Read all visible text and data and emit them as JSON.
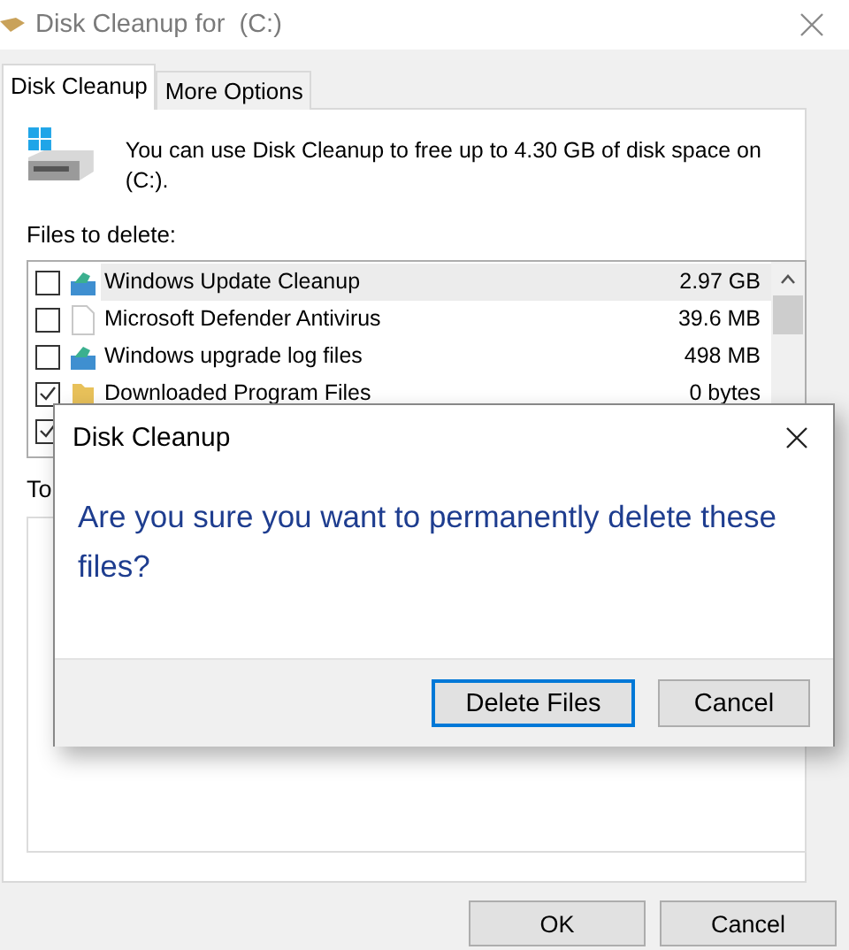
{
  "window": {
    "title": "Disk Cleanup for  (C:)"
  },
  "tabs": [
    {
      "label": "Disk Cleanup",
      "selected": true
    },
    {
      "label": "More Options",
      "selected": false
    }
  ],
  "intro": "You can use Disk Cleanup to free up to 4.30 GB of disk space on (C:).",
  "files_label": "Files to delete:",
  "files": [
    {
      "kind": "update",
      "name": "Windows Update Cleanup",
      "size": "2.97 GB",
      "checked": false,
      "selected": true
    },
    {
      "kind": "document",
      "name": "Microsoft Defender Antivirus",
      "size": "39.6 MB",
      "checked": false,
      "selected": false
    },
    {
      "kind": "update",
      "name": "Windows upgrade log files",
      "size": "498 MB",
      "checked": false,
      "selected": false
    },
    {
      "kind": "folder",
      "name": "Downloaded Program Files",
      "size": "0 bytes",
      "checked": true,
      "selected": false
    },
    {
      "kind": "hidden",
      "checked": true
    }
  ],
  "total_label": "To",
  "buttons": [
    "OK",
    "Cancel"
  ],
  "dialog": {
    "title": "Disk Cleanup",
    "message": "Are you sure you want to permanently delete these files?",
    "buttons": [
      {
        "label": "Delete Files",
        "default": true
      },
      {
        "label": "Cancel",
        "default": false
      }
    ]
  }
}
